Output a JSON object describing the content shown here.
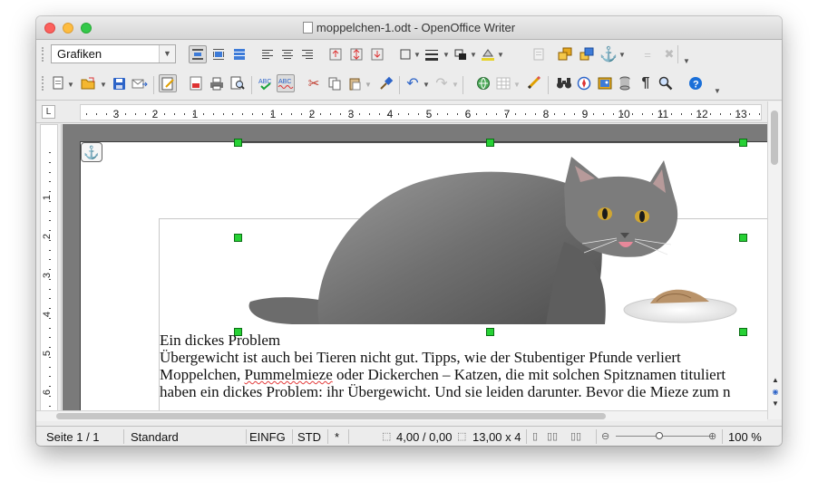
{
  "window": {
    "title": "moppelchen-1.odt - OpenOffice Writer"
  },
  "toolbar1": {
    "style_select": "Grafiken",
    "icons": [
      "wrap-off-icon",
      "wrap-page-icon",
      "wrap-through-icon",
      "align-left-icon",
      "align-center-icon",
      "align-right-icon",
      "align-top-icon",
      "align-middle-icon",
      "align-bottom-icon",
      "border-icon",
      "line-style-icon",
      "border-color-icon",
      "bg-color-icon",
      "properties-icon",
      "bring-front-icon",
      "send-back-icon",
      "anchor-icon",
      "separator-icon",
      "delete-icon"
    ]
  },
  "toolbar2": {
    "icons": [
      "new-doc-icon",
      "open-icon",
      "save-icon",
      "email-icon",
      "edit-mode-icon",
      "pdf-export-icon",
      "print-icon",
      "page-preview-icon",
      "spellcheck-icon",
      "autospell-icon",
      "cut-icon",
      "copy-icon",
      "paste-icon",
      "format-paintbrush-icon",
      "undo-icon",
      "redo-icon",
      "hyperlink-icon",
      "table-icon",
      "draw-icon",
      "find-icon",
      "navigator-icon",
      "gallery-icon",
      "data-source-icon",
      "formatting-marks-icon",
      "zoom-icon",
      "help-icon"
    ]
  },
  "hruler": {
    "numbers": [
      "3",
      "2",
      "1",
      "1",
      "2",
      "3",
      "4",
      "5",
      "6",
      "7",
      "8",
      "9",
      "10",
      "11",
      "12",
      "13"
    ]
  },
  "vruler": {
    "numbers": [
      "1",
      "2",
      "3",
      "4",
      "5",
      "6"
    ]
  },
  "document": {
    "heading": "Ein dickes Problem",
    "line2": "Übergewicht ist auch bei Tieren nicht gut. Tipps, wie der Stubentiger Pfunde verliert",
    "line3_start": "Moppelchen, ",
    "line3_spell": "Pummelmieze",
    "line3_end": " oder Dickerchen – Katzen, die mit solchen Spitznamen tituliert",
    "line4": "haben ein dickes Problem: ihr Übergewicht. Und sie leiden darunter. Bevor die Mieze zum n"
  },
  "statusbar": {
    "page": "Seite 1 / 1",
    "style": "Standard",
    "insert_mode": "EINFG",
    "selection_mode": "STD",
    "modified": "*",
    "position": "4,00 / 0,00",
    "size": "13,00 x 4",
    "zoom": "100 %"
  },
  "colors": {
    "handle": "#27d135",
    "workspace": "#7a7a7a",
    "help_blue": "#1a6fd8"
  }
}
